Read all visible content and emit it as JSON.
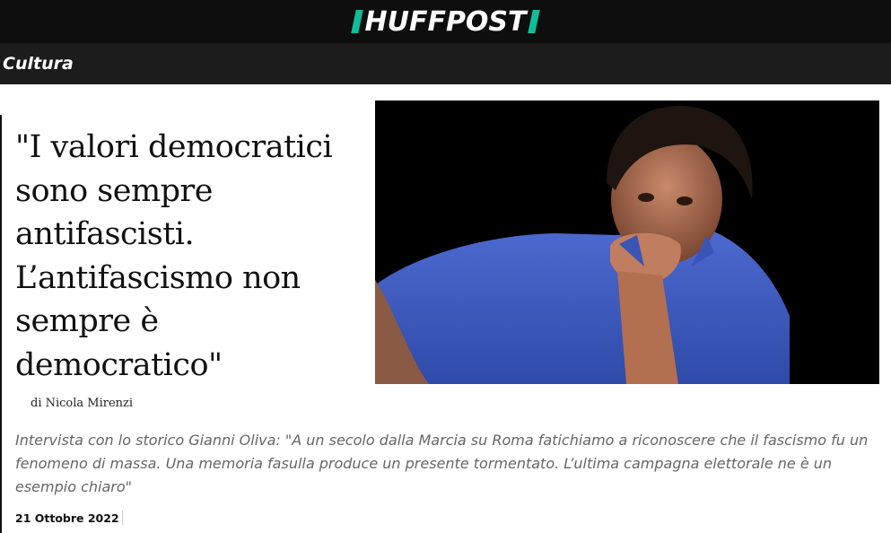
{
  "header": {
    "logo_text": "HUFFPOST",
    "accent_color": "#0dbe98",
    "background_color": "#0e0e0e"
  },
  "section": {
    "label": "Cultura"
  },
  "article": {
    "headline": "\"I valori democratici sono sempre antifascisti. L’antifascismo non sempre è democratico\"",
    "byline": "di Nicola Mirenzi",
    "summary": "Intervista con lo storico Gianni Oliva: \"A un secolo dalla Marcia su Roma fatichiamo a riconoscere che il fascismo fu un fenomeno di massa. Una memoria fasulla produce un presente tormentato. L’ultima campagna elettorale ne è un esempio chiaro\"",
    "date": "21 Ottobre 2022",
    "image_description_icon": "portrait-photo"
  }
}
